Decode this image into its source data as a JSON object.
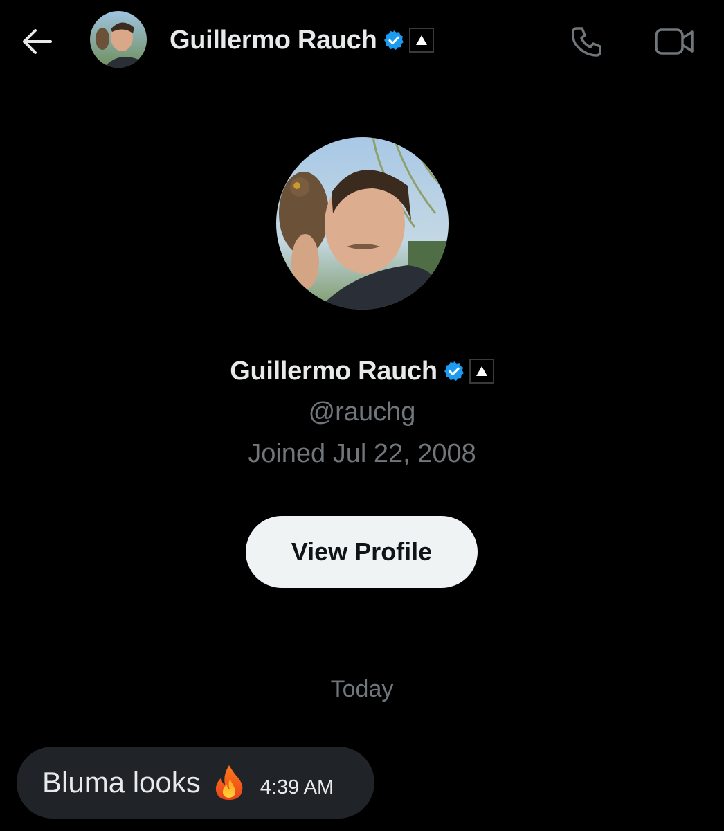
{
  "header": {
    "back_icon": "arrow-left-icon",
    "name": "Guillermo Rauch",
    "verified_icon": "verified-badge-icon",
    "affiliate_icon": "affiliate-triangle-icon",
    "call_icon": "phone-icon",
    "video_icon": "video-camera-icon"
  },
  "profile": {
    "name": "Guillermo Rauch",
    "handle": "@rauchg",
    "joined": "Joined Jul 22, 2008",
    "view_profile_label": "View Profile"
  },
  "conversation": {
    "date_divider": "Today",
    "messages": [
      {
        "text": "Bluma looks",
        "emoji_icon": "fire-emoji-icon",
        "time": "4:39 AM"
      }
    ]
  },
  "colors": {
    "background": "#000000",
    "primary_text": "#e7e9ea",
    "secondary_text": "#71767b",
    "verified_blue": "#1d9bf0",
    "button_bg": "#eff3f4",
    "bubble_bg": "#202327"
  }
}
